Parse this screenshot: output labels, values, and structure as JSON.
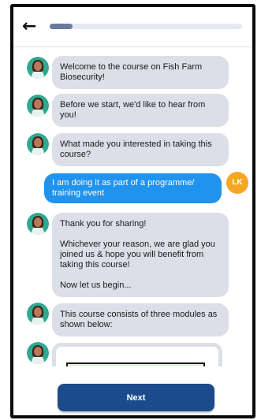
{
  "header": {
    "back_icon": "arrow-left-icon",
    "progress_fraction": 0.12
  },
  "messages": [
    {
      "from": "bot",
      "lines": [
        "Welcome to the course on Fish Farm Biosecurity!"
      ]
    },
    {
      "from": "bot",
      "lines": [
        "Before we start, we'd like to hear from you!"
      ]
    },
    {
      "from": "bot",
      "lines": [
        "What made you interested in taking this course?"
      ]
    },
    {
      "from": "user",
      "lines": [
        "I am doing it as part of a programme/ training event"
      ],
      "initials": "LK"
    },
    {
      "from": "bot",
      "lines": [
        "Thank you for sharing!",
        "Whichever your reason, we are glad you joined us & hope you will benefit from taking this course!",
        "Now let us begin..."
      ]
    },
    {
      "from": "bot",
      "lines": [
        "This course consists of three modules as shown below:"
      ]
    }
  ],
  "footer": {
    "next_label": "Next"
  },
  "colors": {
    "bot_bubble": "#dcdfe7",
    "user_bubble": "#1f93ee",
    "user_avatar": "#f5a623",
    "next_button": "#1b4b8a"
  }
}
